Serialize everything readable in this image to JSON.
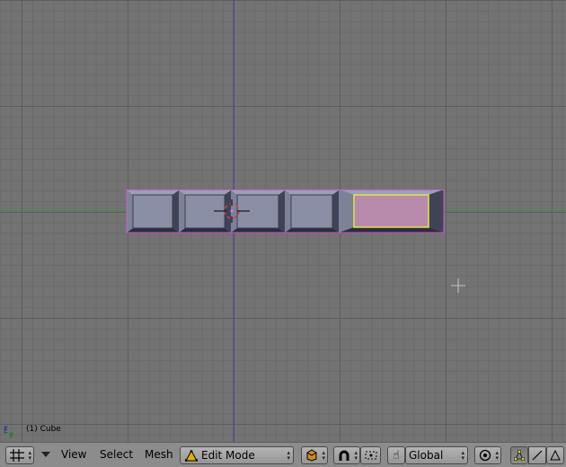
{
  "viewport": {
    "object_info": "(1) Cube",
    "axis_z": "z",
    "axis_y": "y",
    "colors": {
      "background": "#737373",
      "x_axis": "#3a8c3a",
      "y_axis": "#4c3fa0",
      "selected_face": "#b88aac",
      "wire": "#d05ad0"
    }
  },
  "header": {
    "menus": {
      "view": "View",
      "select": "Select",
      "mesh": "Mesh"
    },
    "mode": {
      "value": "Edit Mode",
      "icon": "edit-mode-triangle-icon"
    },
    "orientation": {
      "value": "Global"
    },
    "icons": [
      "window-type-grid-icon",
      "collapse-arrow-icon",
      "draw-type-cube-icon",
      "magnet-snap-icon",
      "pivot-icon",
      "manipulator-hand-icon",
      "proportional-edit-icon",
      "vertex-select-icon",
      "edge-select-icon",
      "face-select-icon"
    ]
  }
}
